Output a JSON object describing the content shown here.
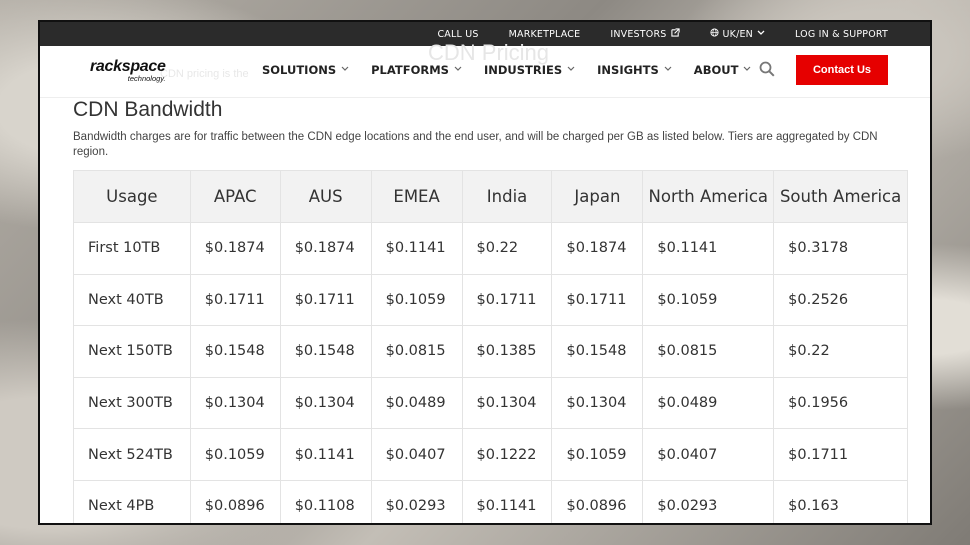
{
  "topbar": {
    "items": [
      "CALL US",
      "MARKETPLACE",
      "INVESTORS",
      "UK/EN",
      "LOG IN & SUPPORT"
    ]
  },
  "header": {
    "ghost_title": "CDN Pricing",
    "ghost_subtitle": "CDN pricing is the",
    "logo_main": "rackspace",
    "logo_sub": "technology.",
    "nav": [
      "SOLUTIONS",
      "PLATFORMS",
      "INDUSTRIES",
      "INSIGHTS",
      "ABOUT"
    ],
    "contact_label": "Contact Us"
  },
  "section": {
    "title": "CDN Bandwidth",
    "description": "Bandwidth charges are for traffic between the CDN edge locations and the end user, and will be charged per GB as listed below. Tiers are aggregated by CDN region."
  },
  "table": {
    "headers": [
      "Usage",
      "APAC",
      "AUS",
      "EMEA",
      "India",
      "Japan",
      "North America",
      "South America"
    ],
    "rows": [
      [
        "First 10TB",
        "$0.1874",
        "$0.1874",
        "$0.1141",
        "$0.22",
        "$0.1874",
        "$0.1141",
        "$0.3178"
      ],
      [
        "Next 40TB",
        "$0.1711",
        "$0.1711",
        "$0.1059",
        "$0.1711",
        "$0.1711",
        "$0.1059",
        "$0.2526"
      ],
      [
        "Next 150TB",
        "$0.1548",
        "$0.1548",
        "$0.0815",
        "$0.1385",
        "$0.1548",
        "$0.0815",
        "$0.22"
      ],
      [
        "Next 300TB",
        "$0.1304",
        "$0.1304",
        "$0.0489",
        "$0.1304",
        "$0.1304",
        "$0.0489",
        "$0.1956"
      ],
      [
        "Next 524TB",
        "$0.1059",
        "$0.1141",
        "$0.0407",
        "$0.1222",
        "$0.1059",
        "$0.0407",
        "$0.1711"
      ],
      [
        "Next 4PB",
        "$0.0896",
        "$0.1108",
        "$0.0293",
        "$0.1141",
        "$0.0896",
        "$0.0293",
        "$0.163"
      ]
    ]
  },
  "colors": {
    "topbar_bg": "#2b2b2b",
    "contact_bg": "#e60000",
    "header_cell_bg": "#f2f2f2"
  }
}
